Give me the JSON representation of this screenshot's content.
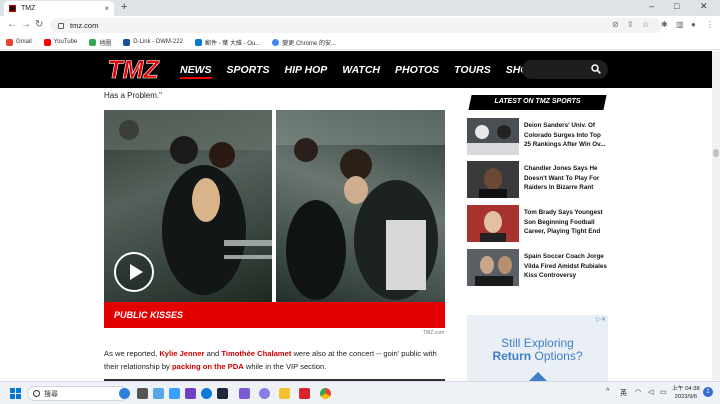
{
  "browser": {
    "tab_title": "TMZ",
    "tab_close": "×",
    "new_tab": "+",
    "url": "tmz.com",
    "window_controls": [
      "–",
      "□",
      "✕"
    ],
    "bookmarks": [
      {
        "label": "Gmail",
        "color": "#ea4335"
      },
      {
        "label": "YouTube",
        "color": "#ff0000"
      },
      {
        "label": "地圖",
        "color": "#34a853"
      },
      {
        "label": "D-Link - DWM-222",
        "color": "#1a4fa0"
      },
      {
        "label": "郵件 - 葉 大維 - Ou...",
        "color": "#0078d4"
      },
      {
        "label": "變更 Chrome 的安...",
        "color": "#4285f4"
      }
    ]
  },
  "tmz": {
    "logo": "TMZ",
    "nav": [
      "NEWS",
      "SPORTS",
      "HIP HOP",
      "WATCH",
      "PHOTOS",
      "TOURS",
      "SHOP"
    ],
    "colors": {
      "brand_red": "#e30000",
      "header_bg": "#000000"
    }
  },
  "article": {
    "lead_fragment": "Has a Problem.\"",
    "video_caption": "PUBLIC KISSES",
    "photo_credit": "TMZ.com",
    "p1_before": "As we reported,",
    "link_kylie": "Kylie Jenner",
    "p1_and": "and",
    "link_timothee": "Timothée Chalamet",
    "p1_mid": "were also at the concert -- goin' public with their relationship by",
    "link_pda": "packing on the PDA",
    "p1_end": "while in the VIP section."
  },
  "sidebar": {
    "header": "LATEST ON TMZ SPORTS",
    "stories": [
      {
        "headline": "Deion Sanders' Univ. Of Colorado Surges Into Top 25 Rankings After Win Ov...",
        "thumb_color": "#4a4f55"
      },
      {
        "headline": "Chandler Jones Says He Doesn't Want To Play For Raiders In Bizarre Rant",
        "thumb_color": "#3a3a3a"
      },
      {
        "headline": "Tom Brady Says Youngest Son Beginning Football Career, Playing Tight End",
        "thumb_color": "#a8322e"
      },
      {
        "headline": "Spain Soccer Coach Jorge Vilda Fired Amidst Rubiales Kiss Controversy",
        "thumb_color": "#5a5f66"
      }
    ],
    "ad": {
      "line1": "Still Exploring",
      "line2_bold": "Return",
      "line2_rest": "Options?"
    }
  },
  "taskbar": {
    "search_placeholder": "搜尋",
    "ime": "英",
    "time": "上午 04:38",
    "date": "2023/9/6",
    "notifications": "1"
  }
}
